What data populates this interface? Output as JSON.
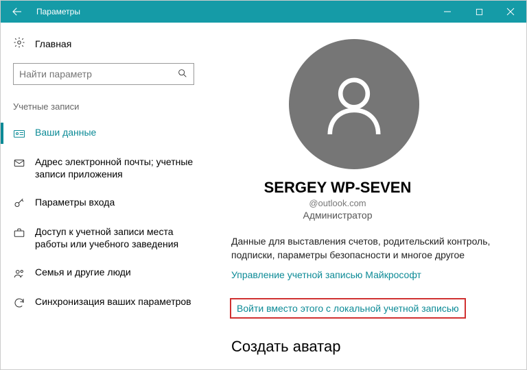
{
  "titlebar": {
    "title": "Параметры"
  },
  "sidebar": {
    "home": "Главная",
    "search_placeholder": "Найти параметр",
    "section": "Учетные записи",
    "items": [
      {
        "label": "Ваши данные"
      },
      {
        "label": "Адрес электронной почты; учетные записи приложения"
      },
      {
        "label": "Параметры входа"
      },
      {
        "label": "Доступ к учетной записи места работы или учебного заведения"
      },
      {
        "label": "Семья и другие люди"
      },
      {
        "label": "Синхронизация ваших параметров"
      }
    ]
  },
  "content": {
    "username": "SERGEY WP-SEVEN",
    "email": "@outlook.com",
    "role": "Администратор",
    "description": "Данные для выставления счетов, родительский контроль, подписки, параметры безопасности и многое другое",
    "manage_link": "Управление учетной записью Майкрософт",
    "switch_link": "Войти вместо этого с локальной учетной записью",
    "create_avatar": "Создать аватар"
  }
}
